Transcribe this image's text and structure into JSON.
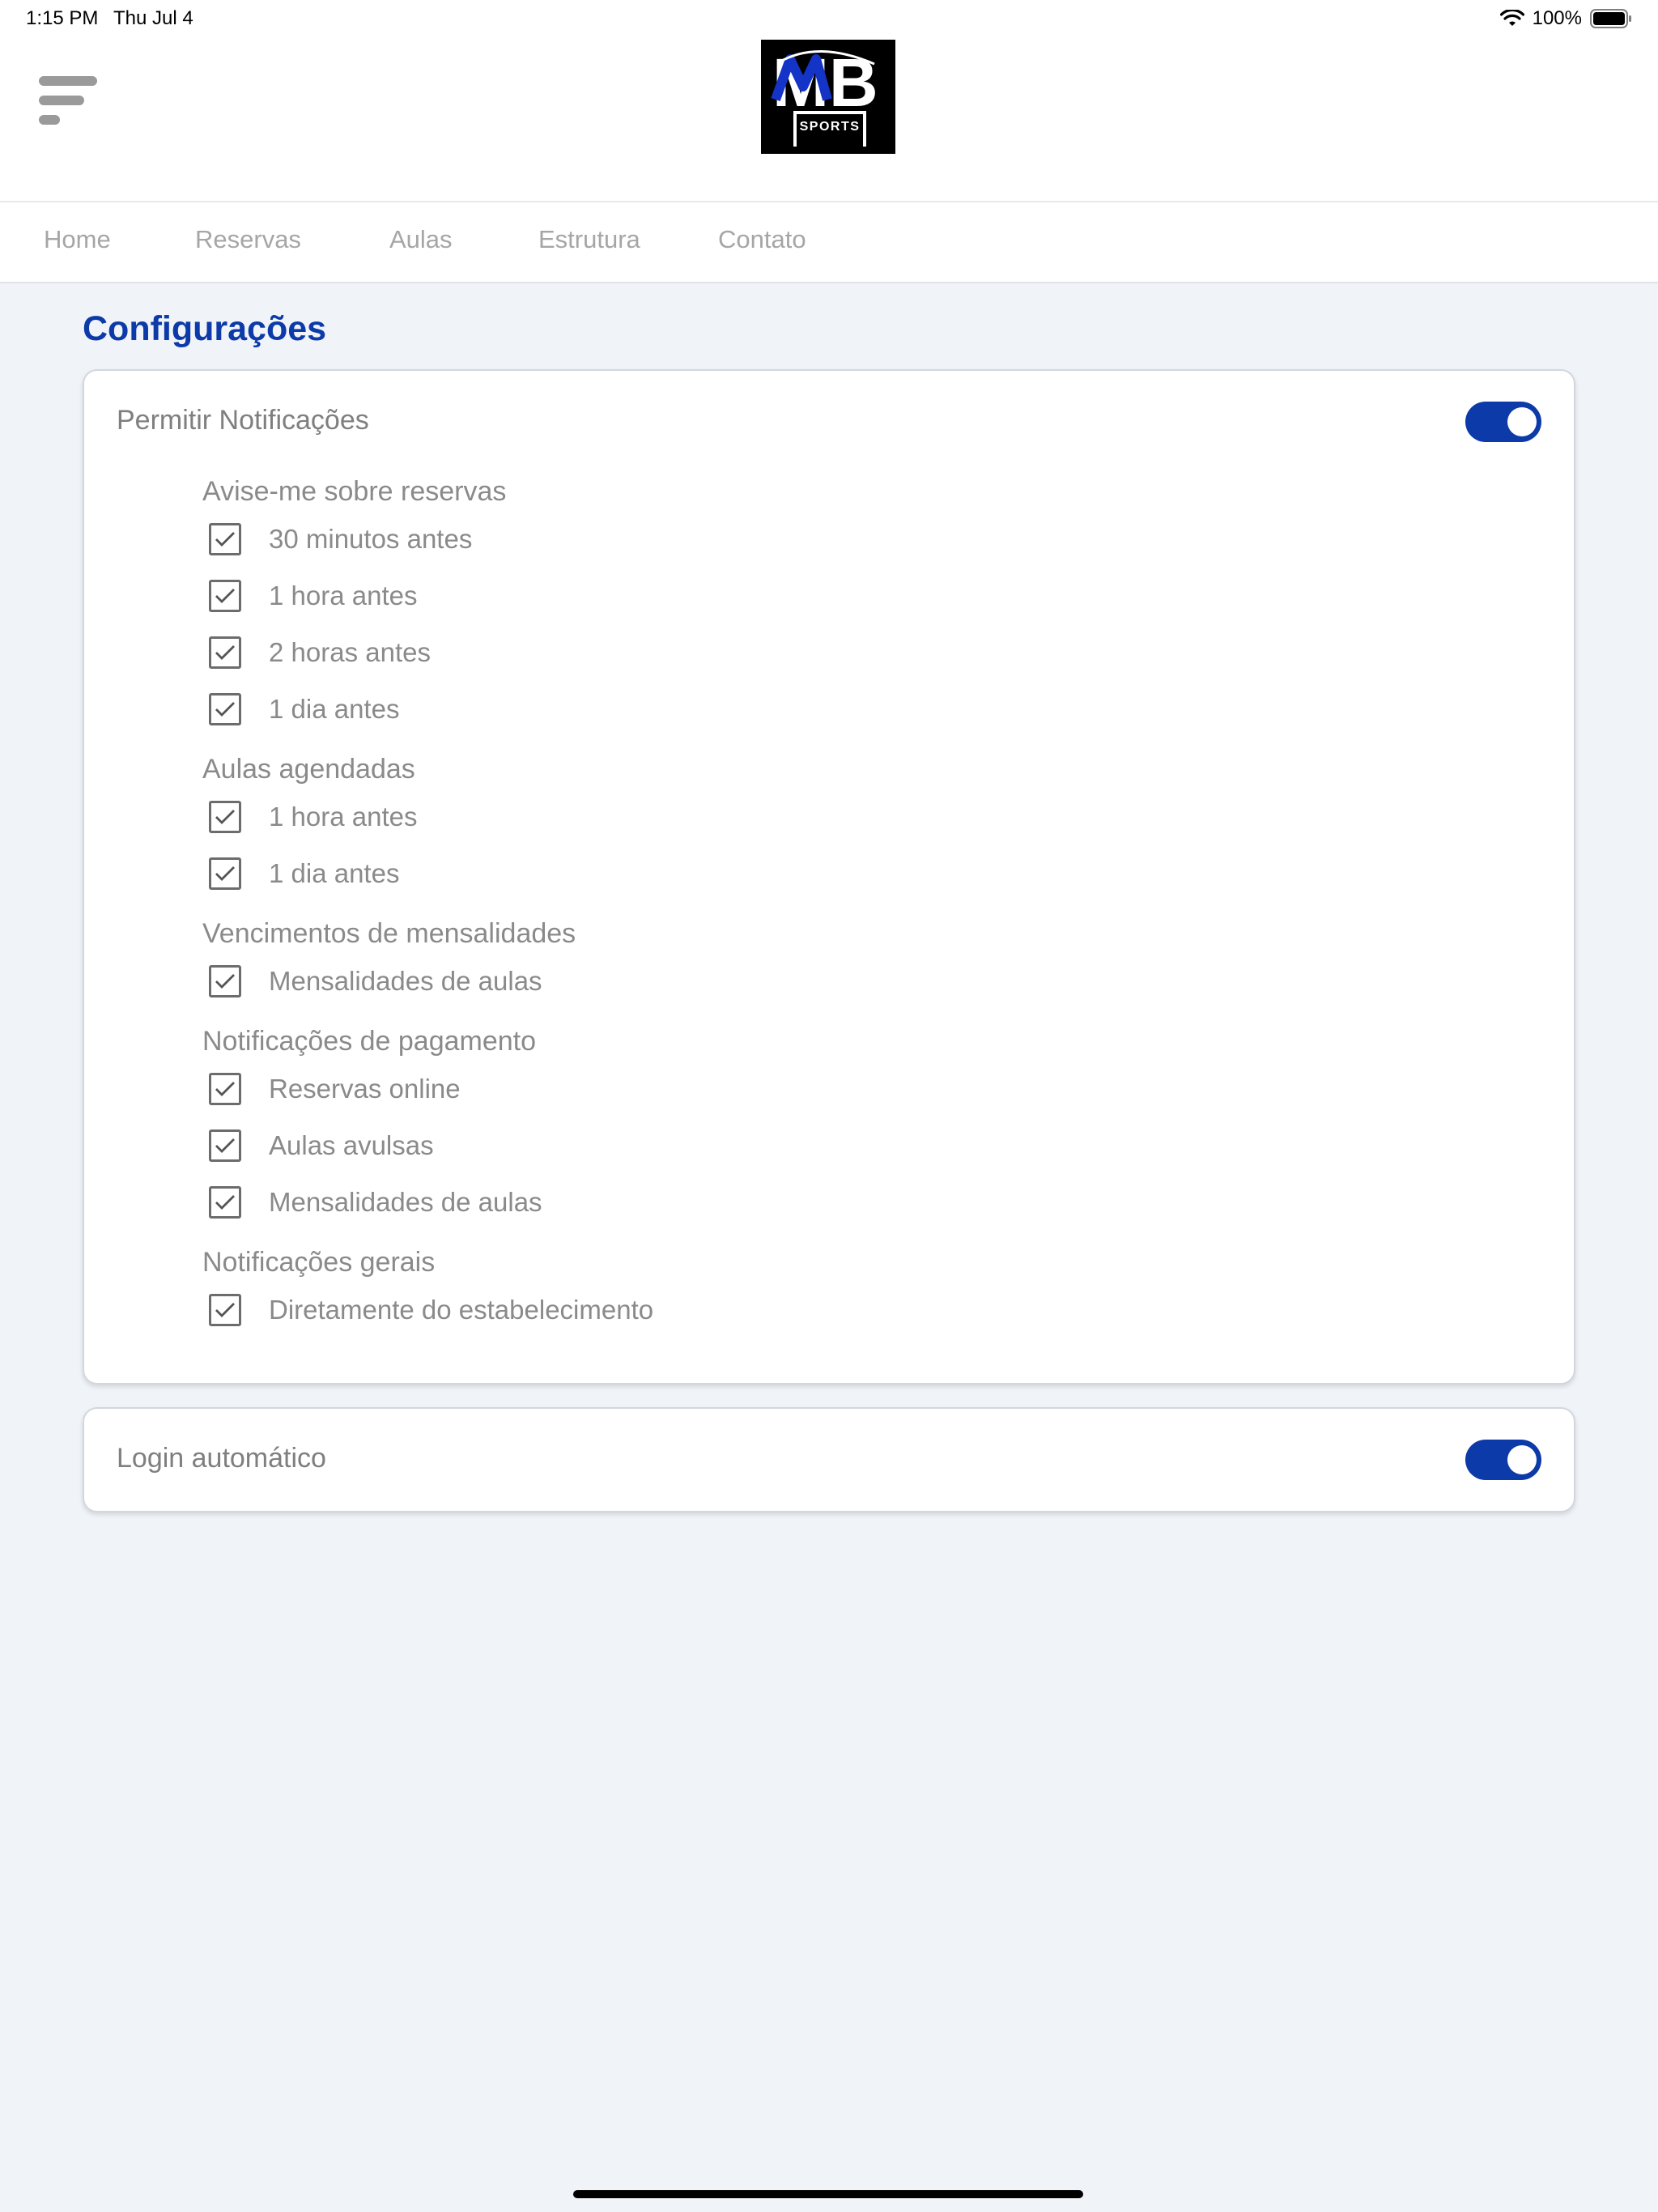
{
  "status_bar": {
    "time": "1:15 PM",
    "date": "Thu Jul 4",
    "battery": "100%"
  },
  "header": {
    "logo_text": "MB",
    "logo_subtext": "SPORTS"
  },
  "nav": {
    "items": [
      "Home",
      "Reservas",
      "Aulas",
      "Estrutura",
      "Contato"
    ]
  },
  "page": {
    "title": "Configurações"
  },
  "notifications_card": {
    "label": "Permitir Notificações",
    "enabled": true,
    "sections": [
      {
        "title": "Avise-me sobre reservas",
        "options": [
          {
            "label": "30 minutos antes",
            "checked": true
          },
          {
            "label": "1 hora antes",
            "checked": true
          },
          {
            "label": "2 horas antes",
            "checked": true
          },
          {
            "label": "1 dia antes",
            "checked": true
          }
        ]
      },
      {
        "title": "Aulas agendadas",
        "options": [
          {
            "label": "1 hora antes",
            "checked": true
          },
          {
            "label": "1 dia antes",
            "checked": true
          }
        ]
      },
      {
        "title": "Vencimentos de mensalidades",
        "options": [
          {
            "label": "Mensalidades de aulas",
            "checked": true
          }
        ]
      },
      {
        "title": "Notificações de pagamento",
        "options": [
          {
            "label": "Reservas online",
            "checked": true
          },
          {
            "label": "Aulas avulsas",
            "checked": true
          },
          {
            "label": "Mensalidades de aulas",
            "checked": true
          }
        ]
      },
      {
        "title": "Notificações gerais",
        "options": [
          {
            "label": "Diretamente do estabelecimento",
            "checked": true
          }
        ]
      }
    ]
  },
  "auto_login_card": {
    "label": "Login automático",
    "enabled": true
  },
  "colors": {
    "accent": "#0c3aa8",
    "background": "#f0f4f8",
    "card": "#ffffff",
    "muted_text": "#8a8a8a"
  },
  "icons": {
    "menu": "menu-icon",
    "toggle": "toggle-switch",
    "checkbox": "checkbox-checked-icon"
  }
}
